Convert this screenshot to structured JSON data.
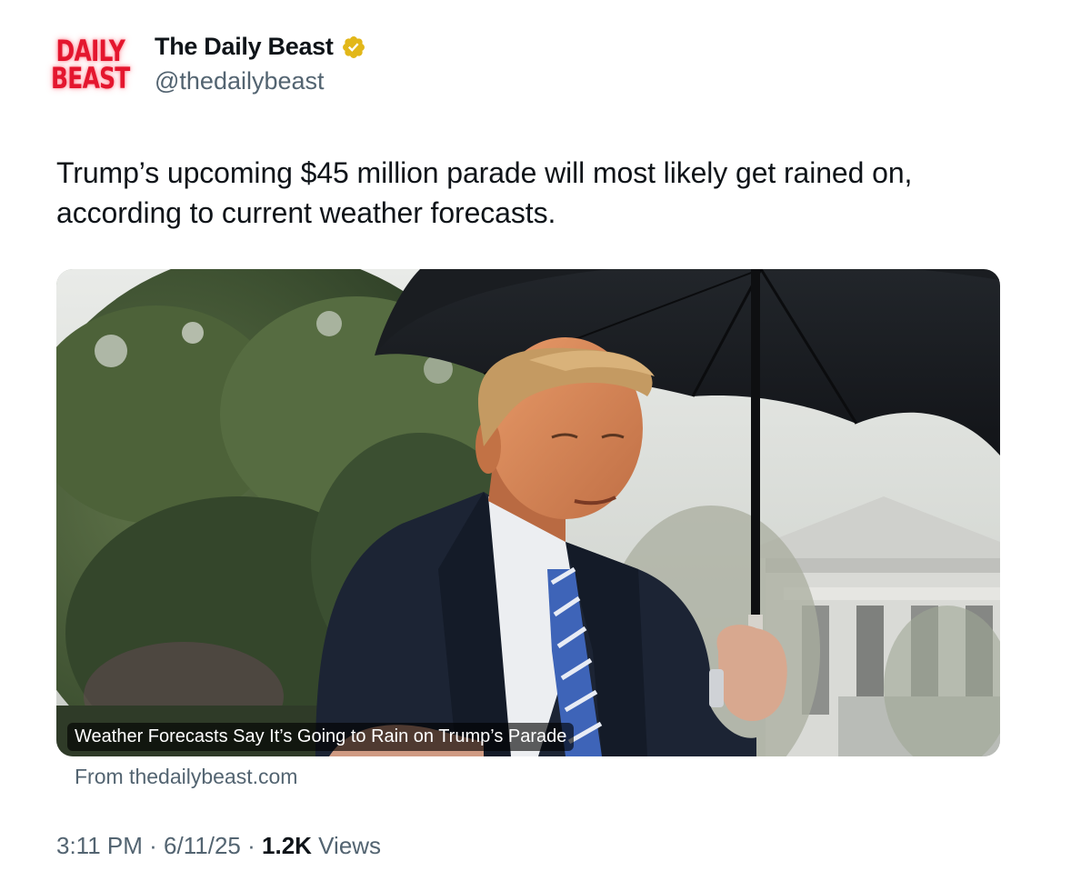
{
  "author": {
    "avatar_lines": [
      "DAILY",
      "BEAST"
    ],
    "name": "The Daily Beast",
    "handle": "@thedailybeast",
    "verified": true,
    "verified_icon": "verified-badge-icon",
    "verified_color": "#e2b719"
  },
  "tweet": {
    "text": "Trump’s upcoming $45 million parade will most likely get rained on, according to current weather forecasts."
  },
  "card": {
    "caption": "Weather Forecasts Say It’s Going to Rain on Trump’s Parade",
    "source": "From thedailybeast.com"
  },
  "meta": {
    "time": "3:11 PM",
    "separator": "·",
    "date": "6/11/25",
    "views_count": "1.2K",
    "views_label": "Views"
  },
  "colors": {
    "text_primary": "#0f1419",
    "text_secondary": "#536471",
    "brand_red": "#e4162e"
  }
}
